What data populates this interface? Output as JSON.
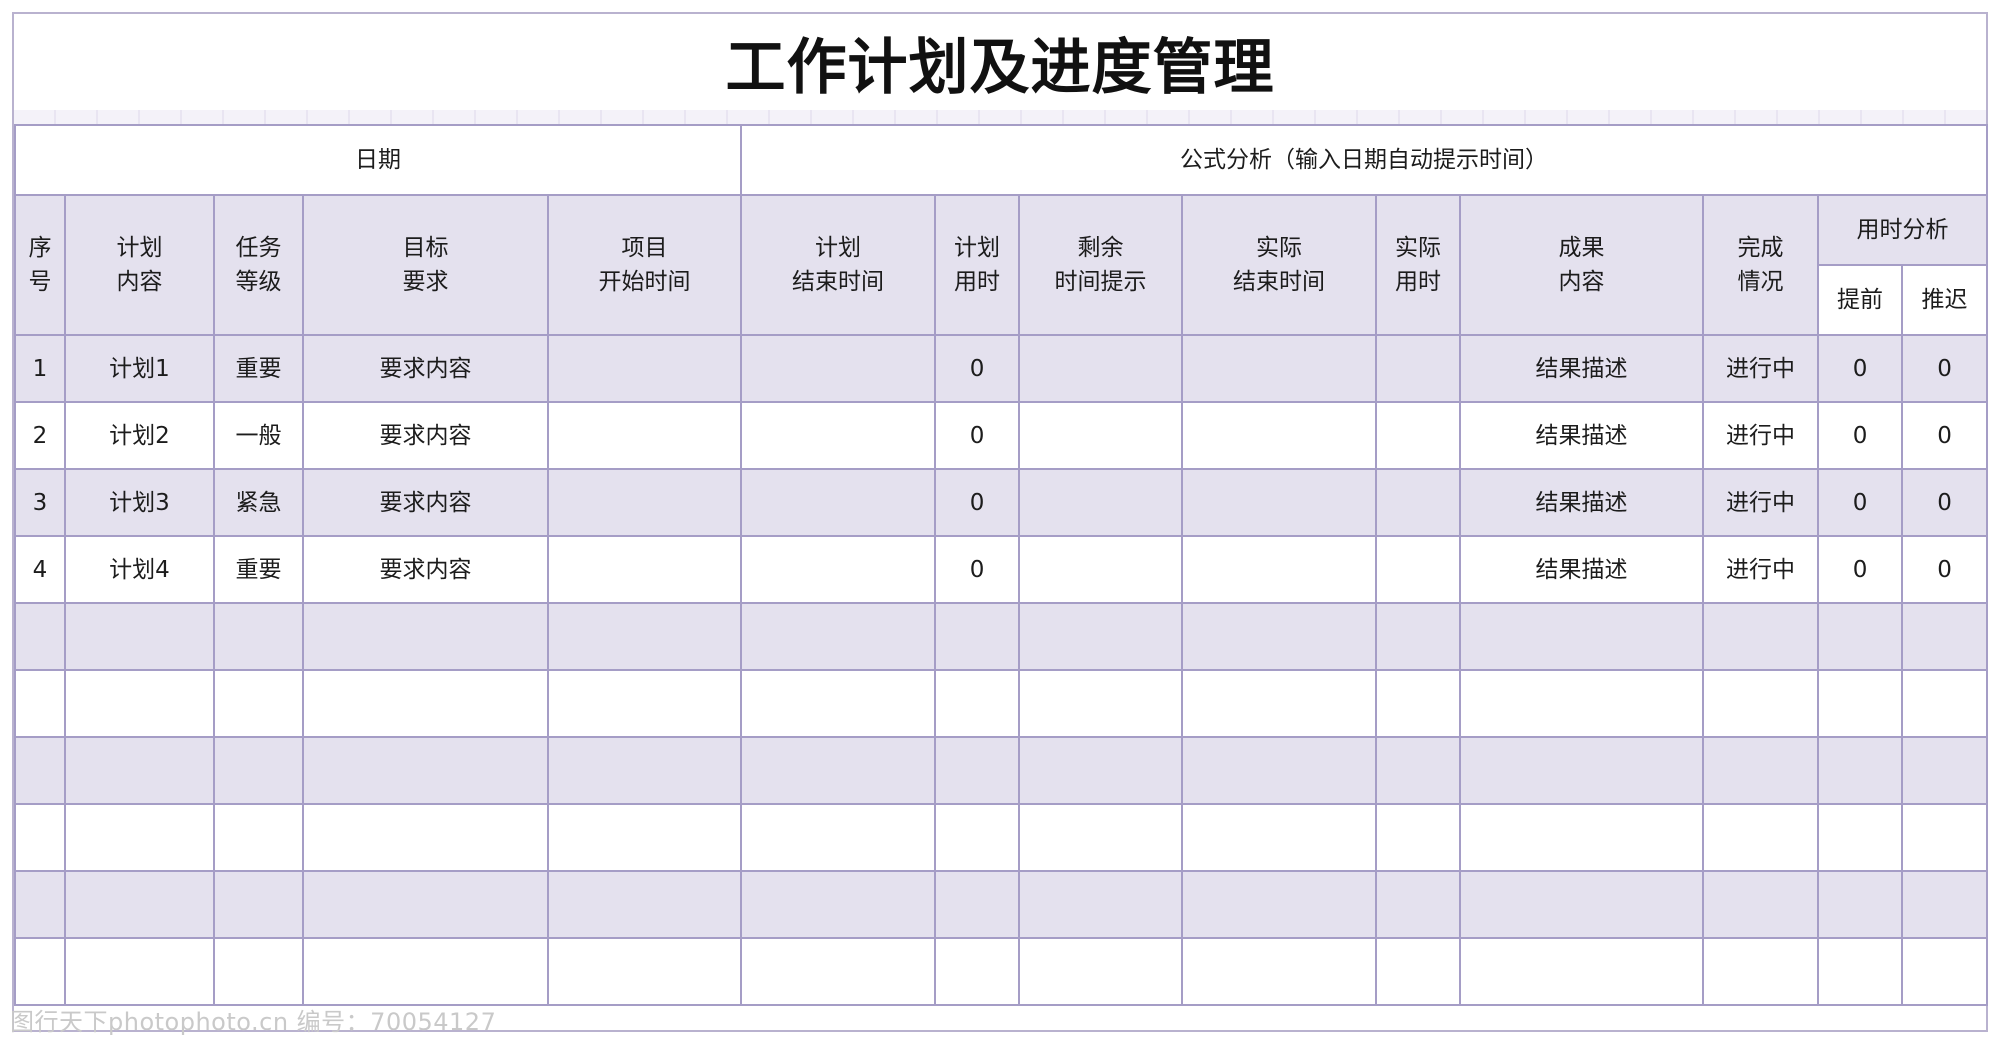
{
  "title": "工作计划及进度管理",
  "sections": {
    "date": "日期",
    "formula": "公式分析（输入日期自动提示时间）"
  },
  "headers": {
    "seq": [
      "序",
      "号"
    ],
    "plan_content": [
      "计划",
      "内容"
    ],
    "task_level": [
      "任务",
      "等级"
    ],
    "target": [
      "目标",
      "要求"
    ],
    "start_time": [
      "项目",
      "开始时间"
    ],
    "plan_end": [
      "计划",
      "结束时间"
    ],
    "plan_used": [
      "计划",
      "用时"
    ],
    "remaining": [
      "剩余",
      "时间提示"
    ],
    "actual_end": [
      "实际",
      "结束时间"
    ],
    "actual_used": [
      "实际",
      "用时"
    ],
    "result": [
      "成果",
      "内容"
    ],
    "status": [
      "完成",
      "情况"
    ],
    "time_analysis": "用时分析",
    "early": "提前",
    "delay": "推迟"
  },
  "rows": [
    {
      "seq": "1",
      "plan": "计划1",
      "level": "重要",
      "target": "要求内容",
      "start": "",
      "plan_end": "",
      "plan_used": "0",
      "remaining": "",
      "actual_end": "",
      "actual_used": "",
      "result": "结果描述",
      "status": "进行中",
      "early": "0",
      "delay": "0"
    },
    {
      "seq": "2",
      "plan": "计划2",
      "level": "一般",
      "target": "要求内容",
      "start": "",
      "plan_end": "",
      "plan_used": "0",
      "remaining": "",
      "actual_end": "",
      "actual_used": "",
      "result": "结果描述",
      "status": "进行中",
      "early": "0",
      "delay": "0"
    },
    {
      "seq": "3",
      "plan": "计划3",
      "level": "紧急",
      "target": "要求内容",
      "start": "",
      "plan_end": "",
      "plan_used": "0",
      "remaining": "",
      "actual_end": "",
      "actual_used": "",
      "result": "结果描述",
      "status": "进行中",
      "early": "0",
      "delay": "0"
    },
    {
      "seq": "4",
      "plan": "计划4",
      "level": "重要",
      "target": "要求内容",
      "start": "",
      "plan_end": "",
      "plan_used": "0",
      "remaining": "",
      "actual_end": "",
      "actual_used": "",
      "result": "结果描述",
      "status": "进行中",
      "early": "0",
      "delay": "0"
    }
  ],
  "empty_row_count": 6,
  "watermark": "图行天下photophoto.cn 编号：70054127",
  "colors": {
    "header_fill": "#e4e1ee",
    "border": "#a59dc6",
    "title_text": "#111111"
  }
}
